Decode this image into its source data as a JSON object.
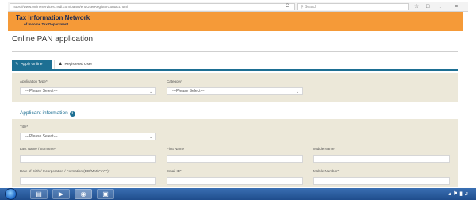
{
  "browser": {
    "url": "https://www.onlineservices.nsdl.com/paam/endUserRegisterContact.html",
    "reload_glyph": "C",
    "search_placeholder": "Search",
    "toolbar_icons": [
      "star-icon",
      "home-icon",
      "download-icon",
      "menu-icon"
    ]
  },
  "header": {
    "title": "Tax Information Network",
    "subtitle": "of Income Tax Department",
    "background_color": "#f59a38"
  },
  "page_title": "Online PAN application",
  "tabs": [
    {
      "label": "Apply Online",
      "active": true,
      "icon": "edit-icon"
    },
    {
      "label": "Registered User",
      "active": false,
      "icon": "user-icon"
    }
  ],
  "application": {
    "type_label": "Application Type*",
    "type_value": "---Please Select---",
    "category_label": "Category*",
    "category_value": "---Please Select---"
  },
  "applicant": {
    "heading": "Applicant information",
    "title_label": "Title*",
    "title_value": "---Please Select---",
    "last_name_label": "Last Name / Surname*",
    "first_name_label": "First Name",
    "middle_name_label": "Middle Name",
    "dob_label": "Date of Birth / Incorporation / Formation (DD/MM/YYYY)*",
    "email_label": "Email ID*",
    "mobile_label": "Mobile Number*"
  },
  "colors": {
    "accent": "#1d6f93",
    "panel": "#ece8d9",
    "taskbar": "#2a5ea3"
  }
}
